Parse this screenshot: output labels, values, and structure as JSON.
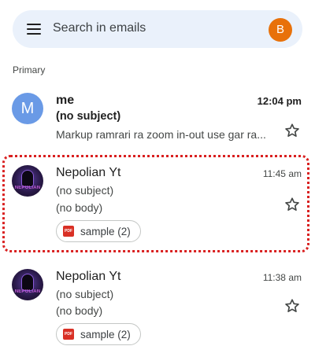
{
  "search": {
    "placeholder": "Search in emails",
    "account_initial": "B",
    "account_color": "#e8710a"
  },
  "section": {
    "label": "Primary"
  },
  "emails": [
    {
      "sender": "me",
      "avatar_initial": "M",
      "avatar_color": "#6a9ae6",
      "time": "12:04 pm",
      "subject": "(no subject)",
      "snippet": "Markup ramrari ra zoom in-out use gar ra...",
      "unread": true,
      "starred": false
    },
    {
      "sender": "Nepolian Yt",
      "avatar_icon": "hooded-figure-avatar",
      "avatar_text": "NEPOLIAN",
      "time": "11:45 am",
      "subject": "(no subject)",
      "snippet": "(no body)",
      "attachment": {
        "icon": "pdf-icon",
        "icon_text": "PDF",
        "label": "sample (2)"
      },
      "unread": false,
      "starred": false,
      "highlighted": true
    },
    {
      "sender": "Nepolian Yt",
      "avatar_icon": "hooded-figure-avatar",
      "avatar_text": "NEPOLIAN",
      "time": "11:38 am",
      "subject": "(no subject)",
      "snippet": "(no body)",
      "attachment": {
        "icon": "pdf-icon",
        "icon_text": "PDF",
        "label": "sample (2)"
      },
      "unread": false,
      "starred": false
    }
  ],
  "colors": {
    "highlight": "#d92020",
    "search_bg": "#eaf1fb",
    "pdf": "#d93025"
  }
}
